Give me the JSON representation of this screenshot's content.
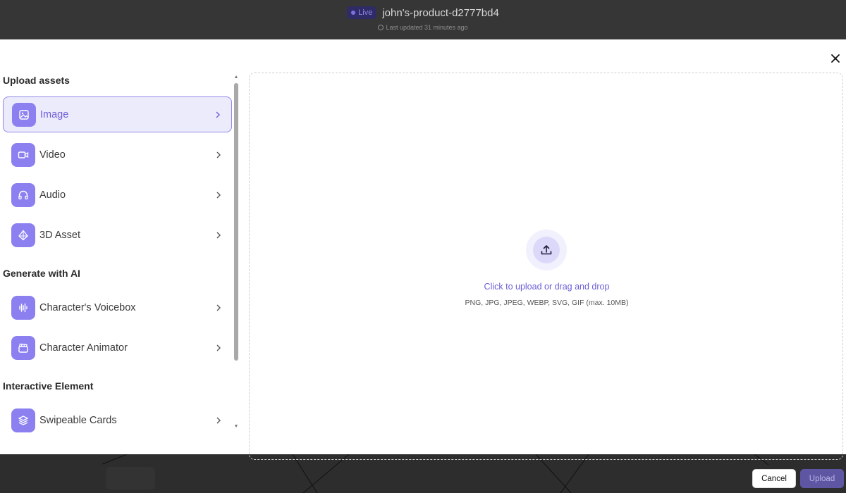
{
  "app": {
    "live_badge": "Live",
    "project_title": "john's-product-d2777bd4",
    "last_updated": "Last updated 31 minutes ago"
  },
  "sidebar": {
    "sections": [
      {
        "title": "Upload assets"
      },
      {
        "title": "Generate with AI"
      },
      {
        "title": "Interactive Element"
      }
    ],
    "items": [
      {
        "label": "Image",
        "icon": "image-icon",
        "selected": true
      },
      {
        "label": "Video",
        "icon": "video-icon"
      },
      {
        "label": "Audio",
        "icon": "headphones-icon"
      },
      {
        "label": "3D Asset",
        "icon": "cube-icon"
      },
      {
        "label": "Character's Voicebox",
        "icon": "waveform-icon"
      },
      {
        "label": "Character Animator",
        "icon": "clapperboard-icon"
      },
      {
        "label": "Swipeable Cards",
        "icon": "layers-icon"
      }
    ]
  },
  "dropzone": {
    "cta": "Click to upload or drag and drop",
    "hint": "PNG, JPG, JPEG, WEBP, SVG, GIF (max. 10MB)"
  },
  "footer": {
    "cancel_label": "Cancel",
    "upload_label": "Upload"
  },
  "colors": {
    "accent": "#8c80f1",
    "accent_text": "#6b5fd6",
    "selected_bg": "#ecebfb"
  }
}
